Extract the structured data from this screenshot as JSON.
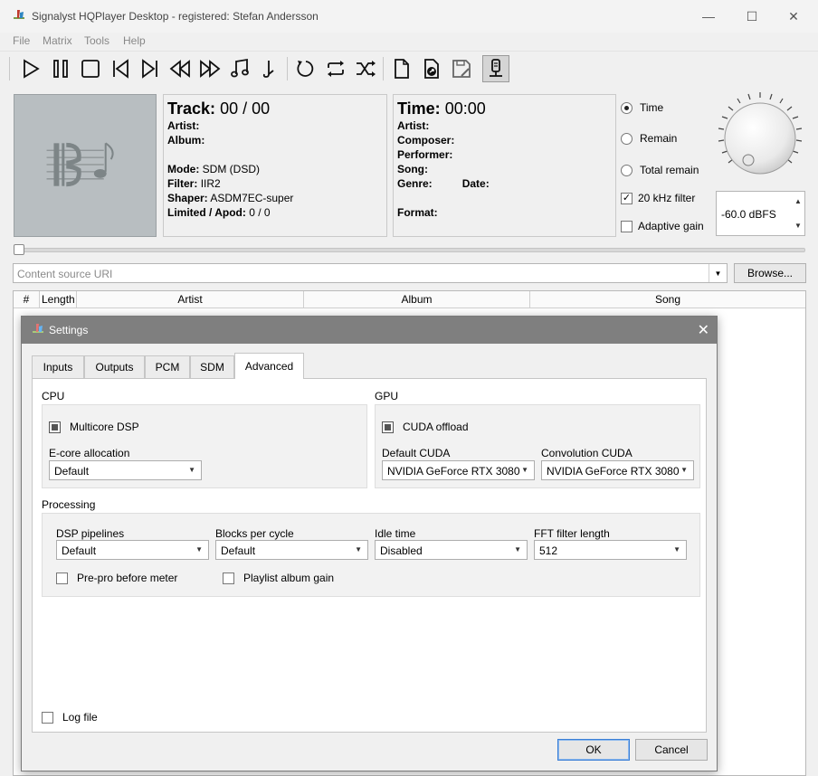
{
  "window": {
    "title": "Signalyst HQPlayer Desktop - registered: Stefan Andersson",
    "controls": {
      "minimize": "—",
      "maximize": "☐",
      "close": "✕"
    }
  },
  "menu": [
    {
      "label": "File"
    },
    {
      "label": "Matrix"
    },
    {
      "label": "Tools"
    },
    {
      "label": "Help"
    }
  ],
  "toolbar_icons": [
    "play-icon",
    "pause-icon",
    "stop-icon",
    "previous-icon",
    "next-icon",
    "rewind-icon",
    "fast-forward-icon",
    "music-note-icon",
    "seek-icon",
    "repeat-one-icon",
    "repeat-icon",
    "shuffle-icon",
    "open-file-icon",
    "open-uri-icon",
    "save-playlist-icon",
    "transport-icon"
  ],
  "track_info": {
    "track_label": "Track:",
    "track_value": "00 / 00",
    "artist_label": "Artist:",
    "album_label": "Album:",
    "mode_label": "Mode:",
    "mode_value": "SDM (DSD)",
    "filter_label": "Filter:",
    "filter_value": "IIR2",
    "shaper_label": "Shaper:",
    "shaper_value": "ASDM7EC-super",
    "limited_label": "Limited / Apod:",
    "limited_value": "0 / 0"
  },
  "time_info": {
    "time_label": "Time:",
    "time_value": "00:00",
    "artist_label": "Artist:",
    "composer_label": "Composer:",
    "performer_label": "Performer:",
    "song_label": "Song:",
    "genre_label": "Genre:",
    "date_label": "Date:",
    "format_label": "Format:"
  },
  "display_mode": {
    "options": [
      "Time",
      "Remain",
      "Total remain"
    ],
    "selected": "Time"
  },
  "checkboxes_main": {
    "khz_filter": {
      "label": "20 kHz filter",
      "checked": true
    },
    "adaptive_gain": {
      "label": "Adaptive gain",
      "checked": false
    }
  },
  "volume": {
    "value": "-60.0 dBFS"
  },
  "uri": {
    "placeholder": "Content source URI"
  },
  "browse_label": "Browse...",
  "playlist_columns": [
    "#",
    "Length",
    "Artist",
    "Album",
    "Song"
  ],
  "settings": {
    "title": "Settings",
    "tabs": [
      "Inputs",
      "Outputs",
      "PCM",
      "SDM",
      "Advanced"
    ],
    "active_tab": "Advanced",
    "cpu": {
      "title": "CPU",
      "multicore_label": "Multicore DSP",
      "ecore_label": "E-core allocation",
      "ecore_value": "Default"
    },
    "gpu": {
      "title": "GPU",
      "cuda_label": "CUDA offload",
      "default_cuda_label": "Default CUDA",
      "default_cuda_value": "NVIDIA GeForce RTX 3080",
      "conv_cuda_label": "Convolution CUDA",
      "conv_cuda_value": "NVIDIA GeForce RTX 3080"
    },
    "processing": {
      "title": "Processing",
      "pipelines_label": "DSP pipelines",
      "pipelines_value": "Default",
      "blocks_label": "Blocks per cycle",
      "blocks_value": "Default",
      "idle_label": "Idle time",
      "idle_value": "Disabled",
      "fft_label": "FFT filter length",
      "fft_value": "512",
      "prepro_label": "Pre-pro before meter",
      "playlist_gain_label": "Playlist album gain"
    },
    "log_file_label": "Log file",
    "ok_label": "OK",
    "cancel_label": "Cancel"
  }
}
